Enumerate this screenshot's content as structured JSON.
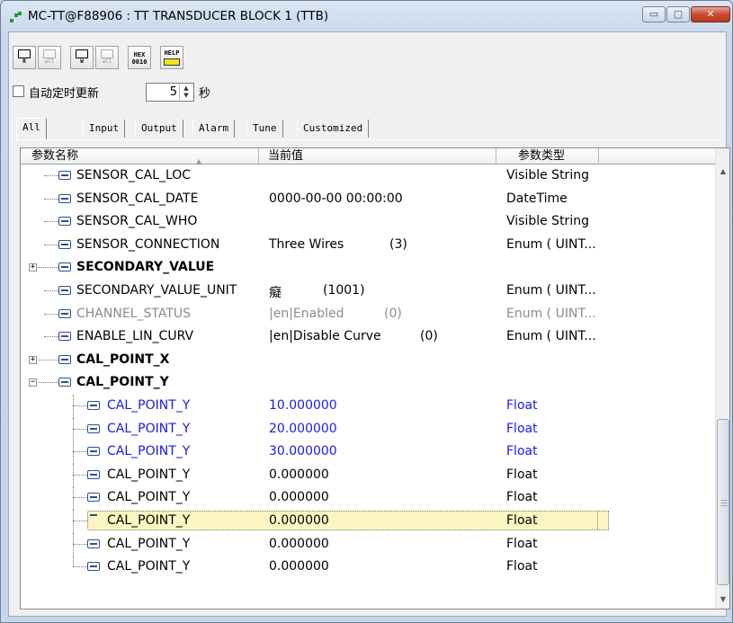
{
  "window": {
    "title": "MC-TT@F88906 : TT TRANSDUCER BLOCK 1 (TTB)",
    "buttons": {
      "minimize": "▭",
      "maximize": "▢",
      "close": "✕"
    }
  },
  "toolbar": {
    "read_label": "R",
    "read_all_label": "all",
    "write_label": "W",
    "write_all_label": "all",
    "hex_label": "HEX",
    "hex_sub": "0010",
    "help_label": "HELP"
  },
  "auto_refresh": {
    "label": "自动定时更新",
    "checked": false,
    "value": "5",
    "unit": "秒"
  },
  "tabs": [
    "All",
    "Input",
    "Output",
    "Alarm",
    "Tune",
    "Customized"
  ],
  "active_tab": "All",
  "columns": {
    "name": "参数名称",
    "value": "当前值",
    "type": "参数类型"
  },
  "rows": [
    {
      "name": "SENSOR_CAL_LOC",
      "value": "",
      "code": "",
      "type": "Visible String",
      "style": "normal",
      "level": 1
    },
    {
      "name": "SENSOR_CAL_DATE",
      "value": "0000-00-00 00:00:00",
      "code": "",
      "type": "DateTime",
      "style": "normal",
      "level": 1
    },
    {
      "name": "SENSOR_CAL_WHO",
      "value": "",
      "code": "",
      "type": "Visible String",
      "style": "normal",
      "level": 1
    },
    {
      "name": "SENSOR_CONNECTION",
      "value": "Three Wires",
      "code": "(3)",
      "type": "Enum ( UINT...",
      "style": "normal",
      "level": 1
    },
    {
      "name": "SECONDARY_VALUE",
      "value": "",
      "code": "",
      "type": "",
      "style": "bold",
      "level": 1,
      "expander": "+"
    },
    {
      "name": "SECONDARY_VALUE_UNIT",
      "value": "癡",
      "code": "(1001)",
      "type": "Enum ( UINT...",
      "style": "normal",
      "level": 1
    },
    {
      "name": "CHANNEL_STATUS",
      "value": "|en|Enabled",
      "code": "(0)",
      "type": "Enum ( UINT...",
      "style": "gray",
      "level": 1
    },
    {
      "name": "ENABLE_LIN_CURV",
      "value": "|en|Disable Curve",
      "code": "(0)",
      "type": "Enum ( UINT...",
      "style": "normal",
      "level": 1
    },
    {
      "name": "CAL_POINT_X",
      "value": "",
      "code": "",
      "type": "",
      "style": "bold",
      "level": 1,
      "expander": "+"
    },
    {
      "name": "CAL_POINT_Y",
      "value": "",
      "code": "",
      "type": "",
      "style": "bold",
      "level": 1,
      "expander": "−"
    },
    {
      "name": "CAL_POINT_Y",
      "value": "10.000000",
      "code": "",
      "type": "Float",
      "style": "blue",
      "level": 2
    },
    {
      "name": "CAL_POINT_Y",
      "value": "20.000000",
      "code": "",
      "type": "Float",
      "style": "blue",
      "level": 2
    },
    {
      "name": "CAL_POINT_Y",
      "value": "30.000000",
      "code": "",
      "type": "Float",
      "style": "blue",
      "level": 2
    },
    {
      "name": "CAL_POINT_Y",
      "value": "0.000000",
      "code": "",
      "type": "Float",
      "style": "normal",
      "level": 2
    },
    {
      "name": "CAL_POINT_Y",
      "value": "0.000000",
      "code": "",
      "type": "Float",
      "style": "normal",
      "level": 2
    },
    {
      "name": "CAL_POINT_Y",
      "value": "0.000000",
      "code": "",
      "type": "Float",
      "style": "selected",
      "level": 2
    },
    {
      "name": "CAL_POINT_Y",
      "value": "0.000000",
      "code": "",
      "type": "Float",
      "style": "normal",
      "level": 2
    },
    {
      "name": "CAL_POINT_Y",
      "value": "0.000000",
      "code": "",
      "type": "Float",
      "style": "normal",
      "level": 2
    }
  ],
  "colors": {
    "accent_blue": "#1a1ae6",
    "selection": "#fbf6c1",
    "disabled_text": "#8c8c8c",
    "help_yellow": "#f5e21a"
  }
}
